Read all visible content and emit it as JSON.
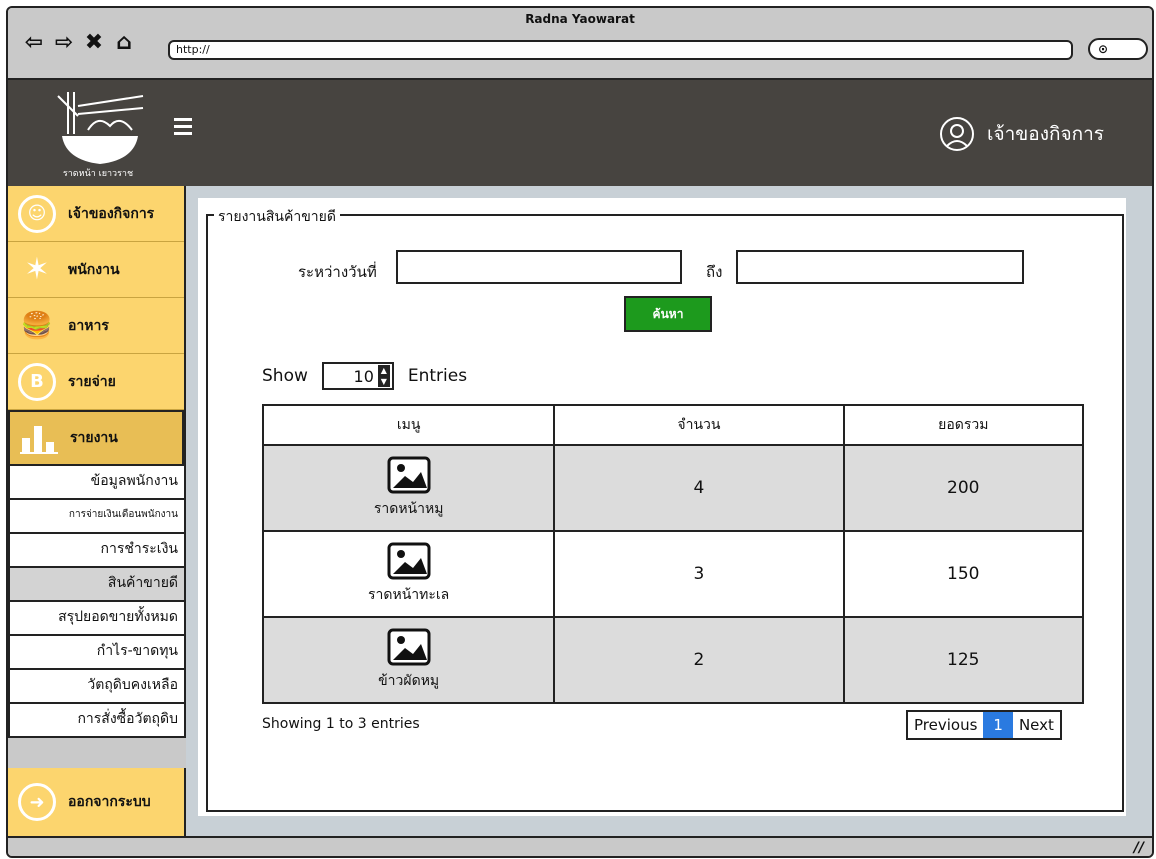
{
  "window": {
    "title": "Radna Yaowarat",
    "url": "http://"
  },
  "header": {
    "logo_text": "ราดหน้า เยาวราช",
    "user_label": "เจ้าของกิจการ"
  },
  "sidebar": {
    "items": [
      {
        "label": "เจ้าของกิจการ",
        "icon": "owner-icon"
      },
      {
        "label": "พนักงาน",
        "icon": "employee-icon"
      },
      {
        "label": "อาหาร",
        "icon": "food-icon"
      },
      {
        "label": "รายจ่าย",
        "icon": "expense-icon"
      },
      {
        "label": "รายงาน",
        "icon": "chart-icon"
      }
    ],
    "report_subitems": [
      "ข้อมูลพนักงาน",
      "การจ่ายเงินเดือนพนักงาน",
      "การชำระเงิน",
      "สินค้าขายดี",
      "สรุปยอดขายทั้งหมด",
      "กำไร-ขาดทุน",
      "วัตถุดิบคงเหลือ",
      "การสั่งซื้อวัตถุดิบ"
    ],
    "logout_label": "ออกจากระบบ"
  },
  "report": {
    "title": "รายงานสินค้าขายดี",
    "date_from_label": "ระหว่างวันที่",
    "date_to_label": "ถึง",
    "search_label": "ค้นหา",
    "show_label": "Show",
    "entries_value": "10",
    "entries_label": "Entries",
    "columns": [
      "เมนู",
      "จำนวน",
      "ยอดรวม"
    ],
    "rows": [
      {
        "menu": "ราดหน้าหมู",
        "qty": "4",
        "total": "200"
      },
      {
        "menu": "ราดหน้าทะเล",
        "qty": "3",
        "total": "150"
      },
      {
        "menu": "ข้าวผัดหมู",
        "qty": "2",
        "total": "125"
      }
    ],
    "info": "Showing 1 to 3 entries",
    "pager": {
      "prev": "Previous",
      "page": "1",
      "next": "Next"
    }
  }
}
